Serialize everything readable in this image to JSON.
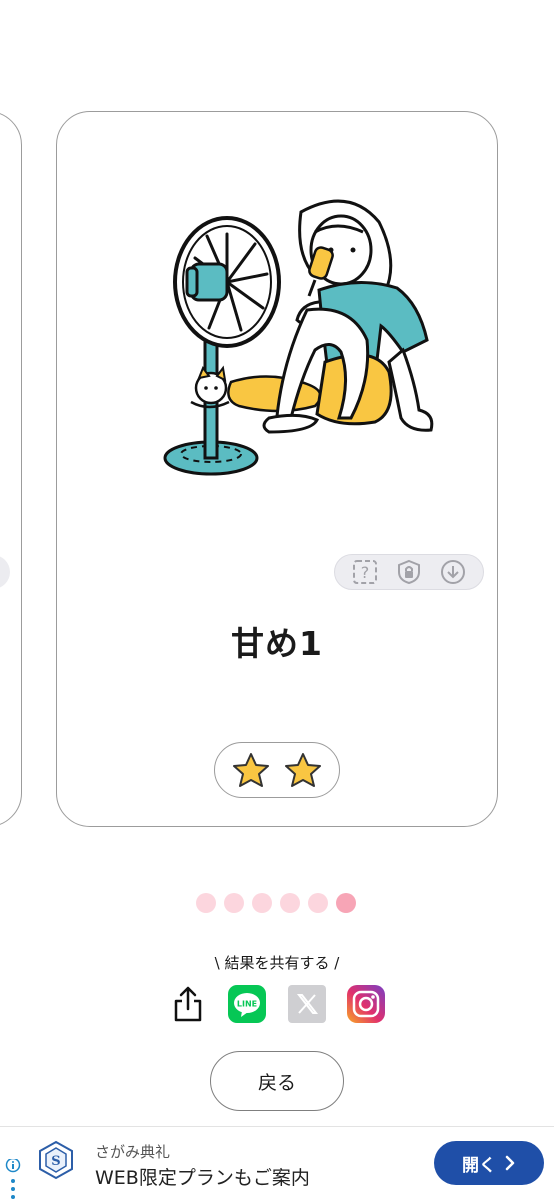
{
  "card": {
    "title": "甘め1",
    "rating": 2,
    "illustration": "girl-with-fan-eating-popsicle-and-cat"
  },
  "card_tools": [
    "question-icon",
    "lock-icon",
    "download-icon"
  ],
  "pagination": {
    "total": 6,
    "active": 6
  },
  "share": {
    "label": "\\ 結果を共有する /",
    "buttons": [
      "share-icon",
      "line-icon",
      "x-icon",
      "instagram-icon"
    ]
  },
  "back_label": "戻る",
  "ad": {
    "subtitle": "さがみ典礼",
    "title": "WEB限定プランもご案内",
    "button_label": "開く"
  },
  "colors": {
    "teal": "#5bbcc2",
    "yellow": "#f9c642",
    "dot_inactive": "#fcd6de",
    "dot_active": "#f7a5b6",
    "ad_button": "#1f4fa8",
    "line_green": "#06c755"
  }
}
